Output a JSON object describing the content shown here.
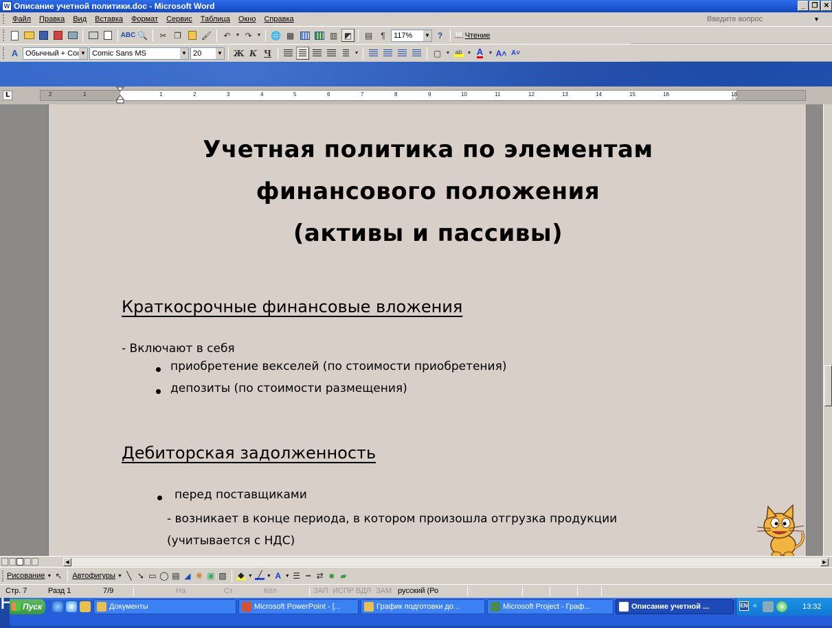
{
  "window": {
    "title": "Описание учетной политики.doc - Microsoft Word",
    "app_icon": "W"
  },
  "menu": {
    "items": [
      "Файл",
      "Правка",
      "Вид",
      "Вставка",
      "Формат",
      "Сервис",
      "Таблица",
      "Окно",
      "Справка"
    ],
    "help_placeholder": "Введите вопрос"
  },
  "toolbar_standard": {
    "zoom": "117%",
    "read_label": "Чтение",
    "pilcrow": "¶"
  },
  "toolbar_formatting": {
    "style": "Обычный + Com",
    "font": "Comic Sans MS",
    "size": "20",
    "bold": "Ж",
    "italic": "К",
    "underline": "Ч"
  },
  "ruler": {
    "corner": "L",
    "ticks": [
      "2",
      "1",
      "1",
      "2",
      "3",
      "4",
      "5",
      "6",
      "7",
      "8",
      "9",
      "10",
      "11",
      "12",
      "13",
      "14",
      "15",
      "16",
      "18"
    ]
  },
  "document": {
    "title_lines": [
      "Учетная политика по элементам",
      "финансового положения",
      "(активы и пассивы)"
    ],
    "section1": {
      "heading": "Краткосрочные финансовые вложения",
      "intro": "- Включают в себя",
      "bullets": [
        "приобретение векселей (по стоимости приобретения)",
        "депозиты (по стоимости размещения)"
      ]
    },
    "section2": {
      "heading": "Дебиторская задолженность",
      "bullet": "перед поставщиками",
      "line1": "- возникает в конце периода, в котором произошла отгрузка продукции",
      "line2": "(учитывается с НДС)"
    }
  },
  "drawing_toolbar": {
    "draw_label": "Рисование",
    "autoshapes_label": "Автофигуры"
  },
  "status": {
    "page": "Стр. 7",
    "section": "Разд 1",
    "pages": "7/9",
    "at": "На",
    "line": "Ст",
    "col": "Кол",
    "rec": "ЗАП",
    "trk": "ИСПР",
    "ext": "ВДЛ",
    "ovr": "ЗАМ",
    "language": "русский (Ро"
  },
  "taskbar": {
    "start": "Пуск",
    "buttons": [
      {
        "label": "Документы",
        "active": false
      },
      {
        "label": "Microsoft PowerPoint - [...",
        "active": false
      },
      {
        "label": "График подготовки до...",
        "active": false
      },
      {
        "label": "Microsoft Project - Граф...",
        "active": false
      },
      {
        "label": "Описание учетной ...",
        "active": true
      }
    ],
    "lang": "EN",
    "clock": "13:32"
  },
  "background": {
    "slide_letter": "F"
  },
  "colors": {
    "titlebar": "#1446c2",
    "page": "#d9cfc9",
    "desktop": "#1f4fae",
    "taskbar": "#245edb"
  }
}
